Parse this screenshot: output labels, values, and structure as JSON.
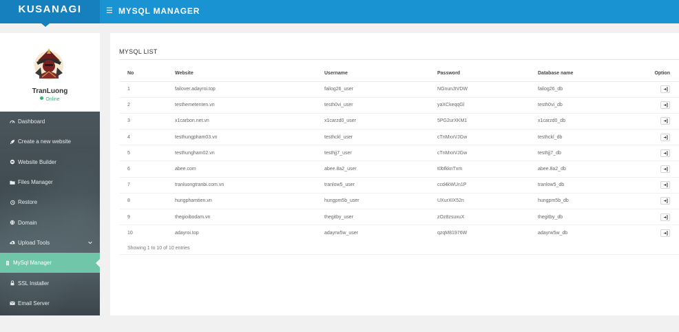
{
  "brand": {
    "name": "KUSANAGI"
  },
  "header": {
    "menu_icon": "menu-icon",
    "title": "MYSQL MANAGER"
  },
  "profile": {
    "name": "TranLuong",
    "status": "Online",
    "status_color": "#2fb676"
  },
  "sidebar": {
    "items": [
      {
        "label": "Dashboard",
        "icon": "dashboard-icon"
      },
      {
        "label": "Create a new website",
        "icon": "rocket-icon"
      },
      {
        "label": "Website Builder",
        "icon": "builder-icon"
      },
      {
        "label": "Files Manager",
        "icon": "folder-icon"
      },
      {
        "label": "Restore",
        "icon": "history-icon"
      },
      {
        "label": "Domain",
        "icon": "globe-icon"
      },
      {
        "label": "Upload Tools",
        "icon": "upload-icon"
      },
      {
        "label": "MySql Manager",
        "icon": "database-icon"
      },
      {
        "label": "SSL Installer",
        "icon": "lock-icon"
      },
      {
        "label": "Email Server",
        "icon": "email-icon"
      }
    ]
  },
  "main": {
    "section_title": "MYSQL LIST",
    "columns": [
      "No",
      "Website",
      "Username",
      "Password",
      "Database name",
      "Option"
    ],
    "rows": [
      {
        "no": "1",
        "website": "failover.adayroi.top",
        "username": "failog26_user",
        "password": "NGnunJtVDW",
        "db": "failog26_db"
      },
      {
        "no": "2",
        "website": "testhemetenten.vn",
        "username": "testh0vi_user",
        "password": "yaXCkeqqGl",
        "db": "testh0vi_db"
      },
      {
        "no": "3",
        "website": "x1carbon.net.vn",
        "username": "x1carzd0_user",
        "password": "5PG2urXKM1",
        "db": "x1carzd0_db"
      },
      {
        "no": "4",
        "website": "testhungpham03.vn",
        "username": "testhckl_user",
        "password": "cTnMxxVJGw",
        "db": "testhckl_db"
      },
      {
        "no": "5",
        "website": "testhungham02.vn",
        "username": "testhjj7_user",
        "password": "cTnMxxVJGw",
        "db": "testhjj7_db"
      },
      {
        "no": "6",
        "website": "abee.com",
        "username": "abee.8a2_user",
        "password": "t0bfkknTxm",
        "db": "abee.8a2_db"
      },
      {
        "no": "7",
        "website": "tranluongtranbi.com.vn",
        "username": "tranlow5_user",
        "password": "ccd4kWUn1P",
        "db": "tranlow5_db"
      },
      {
        "no": "8",
        "website": "hungphamtien.vn",
        "username": "hungpm5b_user",
        "password": "UXurXIX52n",
        "db": "hungpm5b_db"
      },
      {
        "no": "9",
        "website": "thegioibodam.vn",
        "username": "thegitby_user",
        "password": "zOz8zsuxuX",
        "db": "thegitby_db"
      },
      {
        "no": "10",
        "website": "adayroi.top",
        "username": "adayrw5w_user",
        "password": "qzqM81976W",
        "db": "adayrw5w_db"
      }
    ],
    "footer_text": "Showing 1 to 10 of 10 entries"
  },
  "colors": {
    "topbar": "#1a93d3",
    "brand_bg": "#1580bd",
    "active_nav": "#6fc6a8"
  }
}
